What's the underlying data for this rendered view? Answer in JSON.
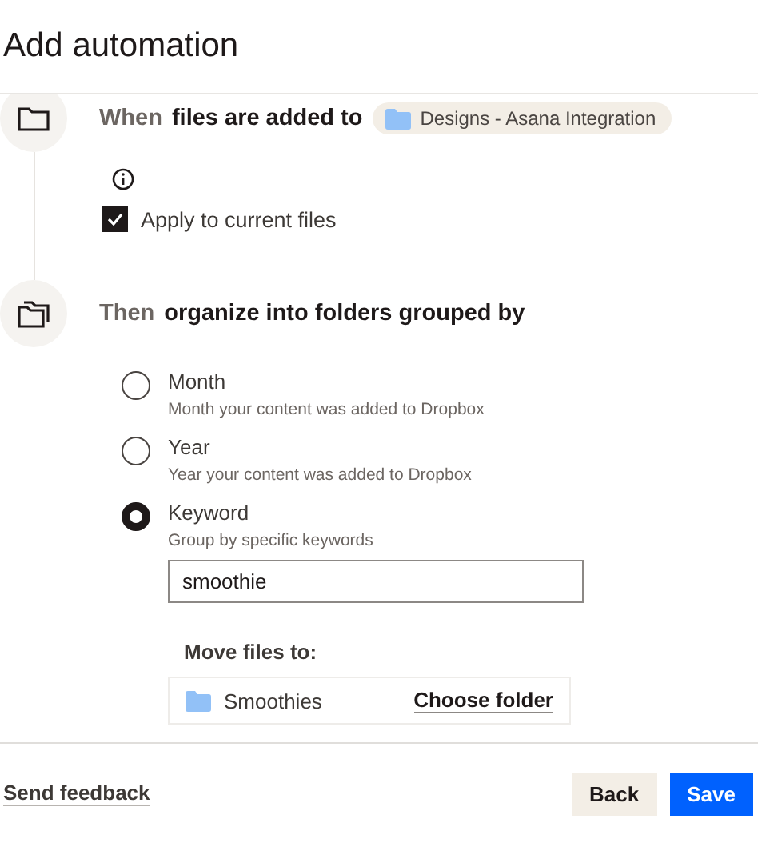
{
  "title": "Add automation",
  "trigger": {
    "lead": "When",
    "text": "files are added to",
    "folder": "Designs - Asana Integration"
  },
  "apply_current": {
    "label": "Apply to current files",
    "checked": true
  },
  "action": {
    "lead": "Then",
    "text": "organize into folders grouped by"
  },
  "options": [
    {
      "label": "Month",
      "description": "Month your content was added to Dropbox",
      "selected": false
    },
    {
      "label": "Year",
      "description": "Year your content was added to Dropbox",
      "selected": false
    },
    {
      "label": "Keyword",
      "description": "Group by specific keywords",
      "selected": true
    }
  ],
  "keyword": {
    "value": "smoothie"
  },
  "move": {
    "label": "Move files to:",
    "folder": "Smoothies",
    "action": "Choose folder"
  },
  "footer": {
    "feedback": "Send feedback",
    "back": "Back",
    "save": "Save"
  }
}
